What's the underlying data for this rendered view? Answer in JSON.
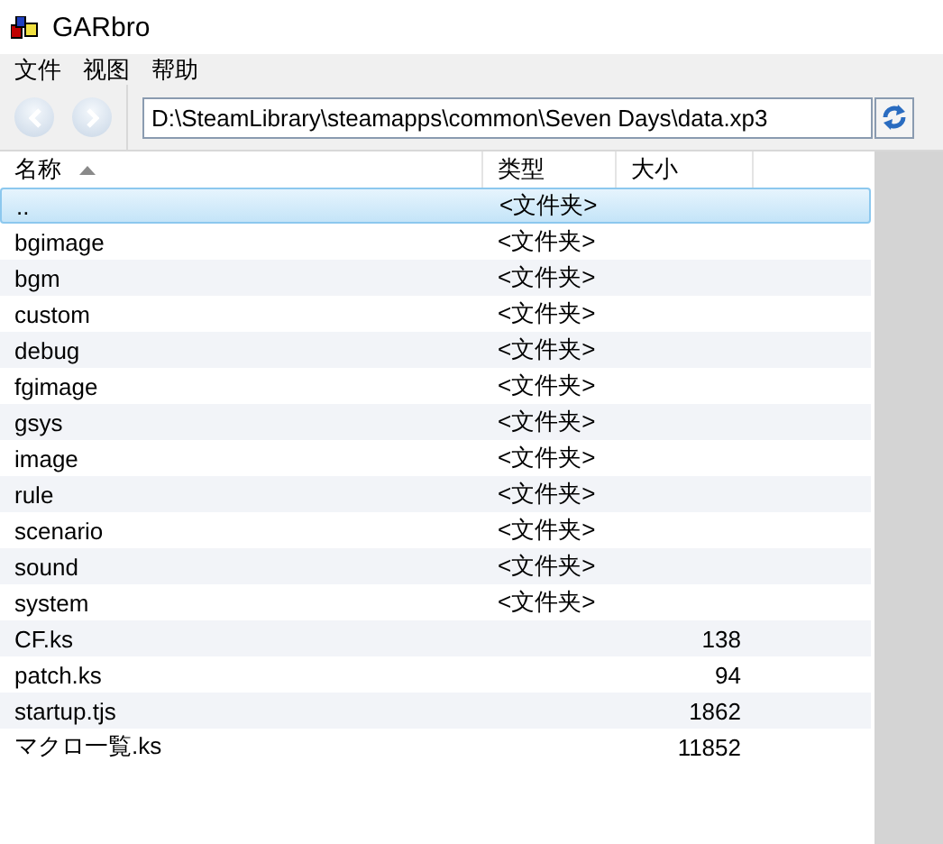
{
  "window": {
    "title": "GARbro"
  },
  "menu": [
    "文件",
    "视图",
    "帮助"
  ],
  "navigation": [
    {
      "kind": "back",
      "disabled": true
    },
    {
      "kind": "forward",
      "disabled": true
    }
  ],
  "address": {
    "value": "D:\\SteamLibrary\\steamapps\\common\\Seven Days\\data.xp3"
  },
  "columns": [
    {
      "label": "名称",
      "sorted": true
    },
    {
      "label": "类型",
      "sorted": false
    },
    {
      "label": "大小",
      "sorted": false
    }
  ],
  "rows": [
    {
      "name": "..",
      "type": "<文件夹>",
      "size": "",
      "selected": true
    },
    {
      "name": "bgimage",
      "type": "<文件夹>",
      "size": "",
      "selected": false
    },
    {
      "name": "bgm",
      "type": "<文件夹>",
      "size": "",
      "selected": false
    },
    {
      "name": "custom",
      "type": "<文件夹>",
      "size": "",
      "selected": false
    },
    {
      "name": "debug",
      "type": "<文件夹>",
      "size": "",
      "selected": false
    },
    {
      "name": "fgimage",
      "type": "<文件夹>",
      "size": "",
      "selected": false
    },
    {
      "name": "gsys",
      "type": "<文件夹>",
      "size": "",
      "selected": false
    },
    {
      "name": "image",
      "type": "<文件夹>",
      "size": "",
      "selected": false
    },
    {
      "name": "rule",
      "type": "<文件夹>",
      "size": "",
      "selected": false
    },
    {
      "name": "scenario",
      "type": "<文件夹>",
      "size": "",
      "selected": false
    },
    {
      "name": "sound",
      "type": "<文件夹>",
      "size": "",
      "selected": false
    },
    {
      "name": "system",
      "type": "<文件夹>",
      "size": "",
      "selected": false
    },
    {
      "name": "CF.ks",
      "type": "",
      "size": "138",
      "selected": false
    },
    {
      "name": "patch.ks",
      "type": "",
      "size": "94",
      "selected": false
    },
    {
      "name": "startup.tjs",
      "type": "",
      "size": "1862",
      "selected": false
    },
    {
      "name": "マクロ一覧.ks",
      "type": "",
      "size": "11852",
      "selected": false
    }
  ]
}
